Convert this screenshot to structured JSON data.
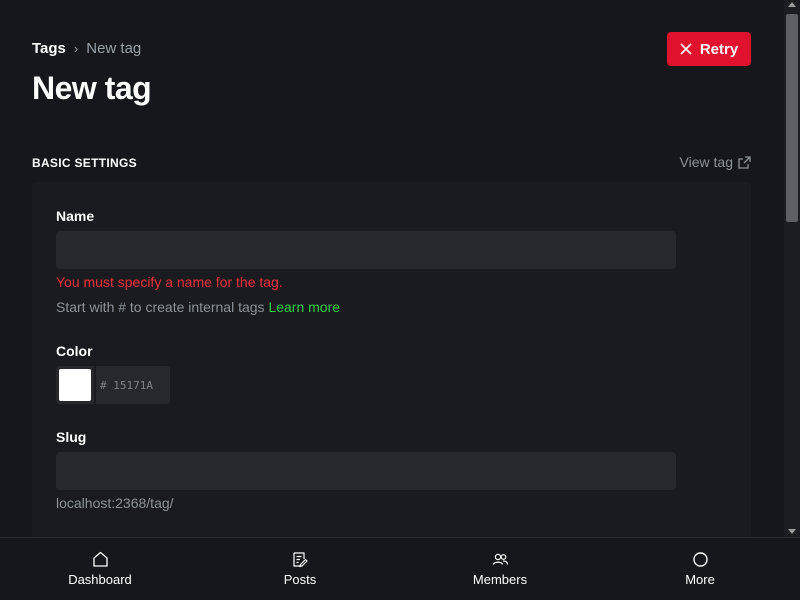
{
  "breadcrumb": {
    "parent": "Tags",
    "separator": "›",
    "current": "New tag"
  },
  "page_title": "New tag",
  "retry_button": {
    "label": "Retry",
    "color": "#e0122d"
  },
  "section": {
    "title": "BASIC SETTINGS",
    "view_tag": "View tag"
  },
  "name_field": {
    "label": "Name",
    "value": "",
    "error": "You must specify a name for the tag.",
    "hint": "Start with # to create internal tags",
    "hint_link": "Learn more"
  },
  "color_field": {
    "label": "Color",
    "swatch": "#ffffff",
    "hex_placeholder": "# 15171A"
  },
  "slug_field": {
    "label": "Slug",
    "value": "",
    "hint": "localhost:2368/tag/"
  },
  "bottom_nav": [
    {
      "label": "Dashboard",
      "icon": "home-icon"
    },
    {
      "label": "Posts",
      "icon": "posts-icon"
    },
    {
      "label": "Members",
      "icon": "members-icon"
    },
    {
      "label": "More",
      "icon": "more-icon"
    }
  ],
  "colors": {
    "background": "#15171a",
    "panel": "#191b1f",
    "input": "#26282c",
    "error": "#f02f3e",
    "link": "#30cf43"
  }
}
